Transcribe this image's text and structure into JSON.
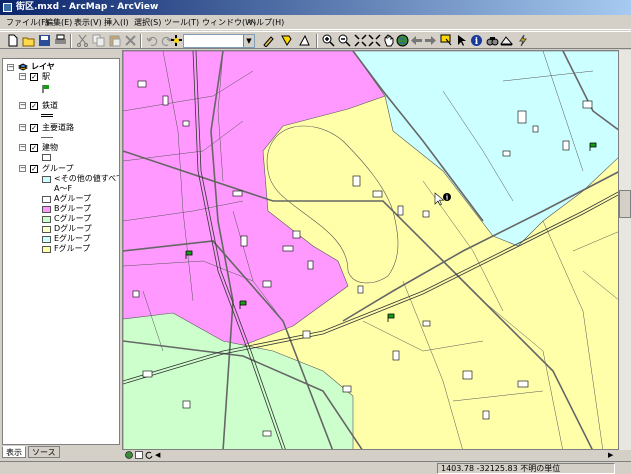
{
  "window": {
    "title": "街区.mxd - ArcMap - ArcView"
  },
  "menu": [
    "ファイル(F)",
    "編集(E)",
    "表示(V)",
    "挿入(I)",
    "選択(S)",
    "ツール(T)",
    "ウィンドウ(W)",
    "ヘルプ(H)"
  ],
  "toc": {
    "root": "レイヤ",
    "layers": [
      {
        "name": "駅",
        "checked": true
      },
      {
        "name": "鉄道",
        "checked": true
      },
      {
        "name": "主要道路",
        "checked": true
      },
      {
        "name": "建物",
        "checked": true
      },
      {
        "name": "グループ",
        "checked": true
      }
    ],
    "group_legend": [
      {
        "label": "<その他の値すべて>",
        "color": "#ccffff"
      },
      {
        "label": "A～F",
        "color": ""
      },
      {
        "label": "Aグループ",
        "color": "#ffffff"
      },
      {
        "label": "Bグループ",
        "color": "#ff99ff"
      },
      {
        "label": "Cグループ",
        "color": "#ccffcc"
      },
      {
        "label": "Dグループ",
        "color": "#ffffcc"
      },
      {
        "label": "Eグループ",
        "color": "#ccffff"
      },
      {
        "label": "Fグループ",
        "color": "#ffffaa"
      }
    ],
    "tabs": [
      "表示",
      "ソース"
    ]
  },
  "toolbar_icons": [
    "new-icon",
    "open-icon",
    "save-icon",
    "print-icon",
    "cut-icon",
    "copy-icon",
    "paste-icon",
    "delete-icon",
    "undo-icon",
    "redo-icon",
    "add-data-icon",
    "editor-icon",
    "identify-tool-icon",
    "zoom-in-icon",
    "zoom-out-icon",
    "fixed-zoom-in-icon",
    "fixed-zoom-out-icon",
    "pan-icon",
    "full-extent-icon",
    "back-icon",
    "forward-icon",
    "select-features-icon",
    "select-elements-icon",
    "info-icon",
    "find-icon",
    "measure-icon",
    "hyperlink-icon"
  ],
  "status": {
    "coordinates": "1403.78  -32125.83 不明の単位"
  },
  "colors": {
    "zone_pink": "#ff99ff",
    "zone_green": "#ccffcc",
    "zone_cyan": "#ccffff",
    "zone_yellow": "#ffffaa",
    "road": "#666666"
  }
}
